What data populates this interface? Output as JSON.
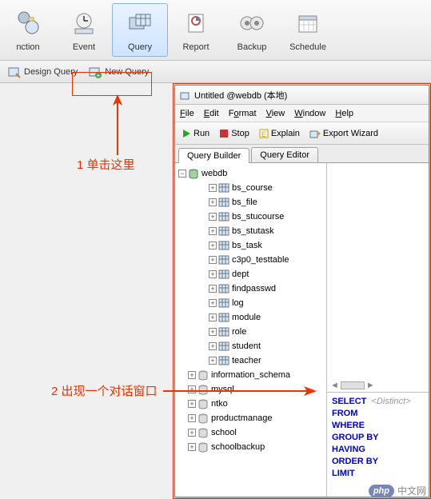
{
  "toolbar": {
    "items": [
      {
        "label": "nction",
        "name": "toolbar-function"
      },
      {
        "label": "Event",
        "name": "toolbar-event"
      },
      {
        "label": "Query",
        "name": "toolbar-query",
        "active": true
      },
      {
        "label": "Report",
        "name": "toolbar-report"
      },
      {
        "label": "Backup",
        "name": "toolbar-backup"
      },
      {
        "label": "Schedule",
        "name": "toolbar-schedule"
      }
    ]
  },
  "sub_toolbar": {
    "design": "Design Query",
    "new": "New Query"
  },
  "dialog": {
    "title": "Untitled @webdb (本地)",
    "menu": {
      "file": "File",
      "edit": "Edit",
      "format": "Format",
      "view": "View",
      "window": "Window",
      "help": "Help"
    },
    "actions": {
      "run": "Run",
      "stop": "Stop",
      "explain": "Explain",
      "export": "Export Wizard"
    },
    "tabs": {
      "builder": "Query Builder",
      "editor": "Query Editor"
    }
  },
  "tree": {
    "root": "webdb",
    "tables": [
      "bs_course",
      "bs_file",
      "bs_stucourse",
      "bs_stutask",
      "bs_task",
      "c3p0_testtable",
      "dept",
      "findpasswd",
      "log",
      "module",
      "role",
      "student",
      "teacher"
    ],
    "dbs": [
      "information_schema",
      "mysql",
      "ntko",
      "productmanage",
      "school",
      "schoolbackup"
    ]
  },
  "sql": {
    "keywords": [
      "SELECT",
      "FROM",
      "WHERE",
      "GROUP BY",
      "HAVING",
      "ORDER BY",
      "LIMIT"
    ],
    "distinct": "<Distinct>"
  },
  "annotations": {
    "a1": "1 单击这里",
    "a2": "2 出现一个对话窗口"
  },
  "watermark": {
    "badge": "php",
    "text": "中文网"
  }
}
